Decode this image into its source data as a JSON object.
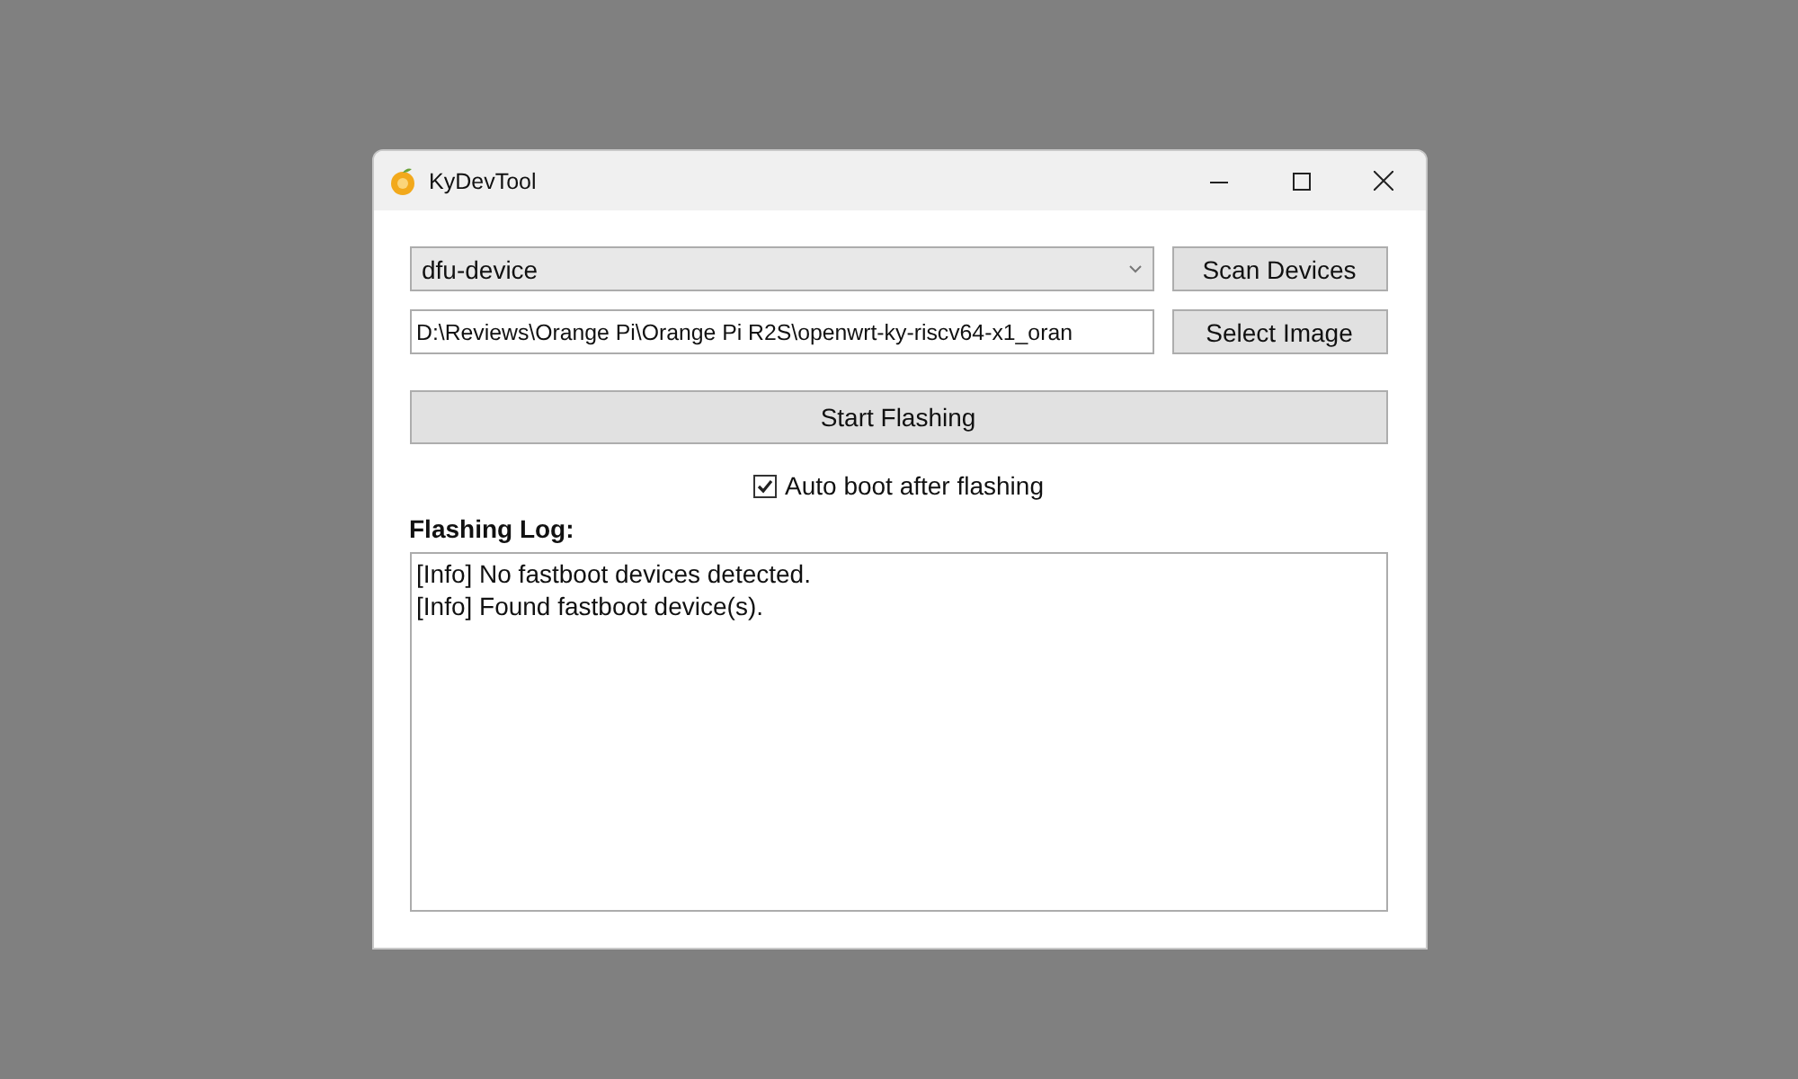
{
  "window": {
    "title": "KyDevTool"
  },
  "device_select": {
    "value": "dfu-device"
  },
  "scan_button": "Scan Devices",
  "image_path": {
    "value": "D:\\Reviews\\Orange Pi\\Orange Pi R2S\\openwrt-ky-riscv64-x1_oran"
  },
  "select_image_button": "Select Image",
  "start_button": "Start Flashing",
  "auto_boot": {
    "label": "Auto boot after flashing",
    "checked": true
  },
  "log": {
    "label": "Flashing Log:",
    "lines": [
      "[Info] No fastboot devices detected.",
      "[Info] Found fastboot device(s)."
    ]
  }
}
